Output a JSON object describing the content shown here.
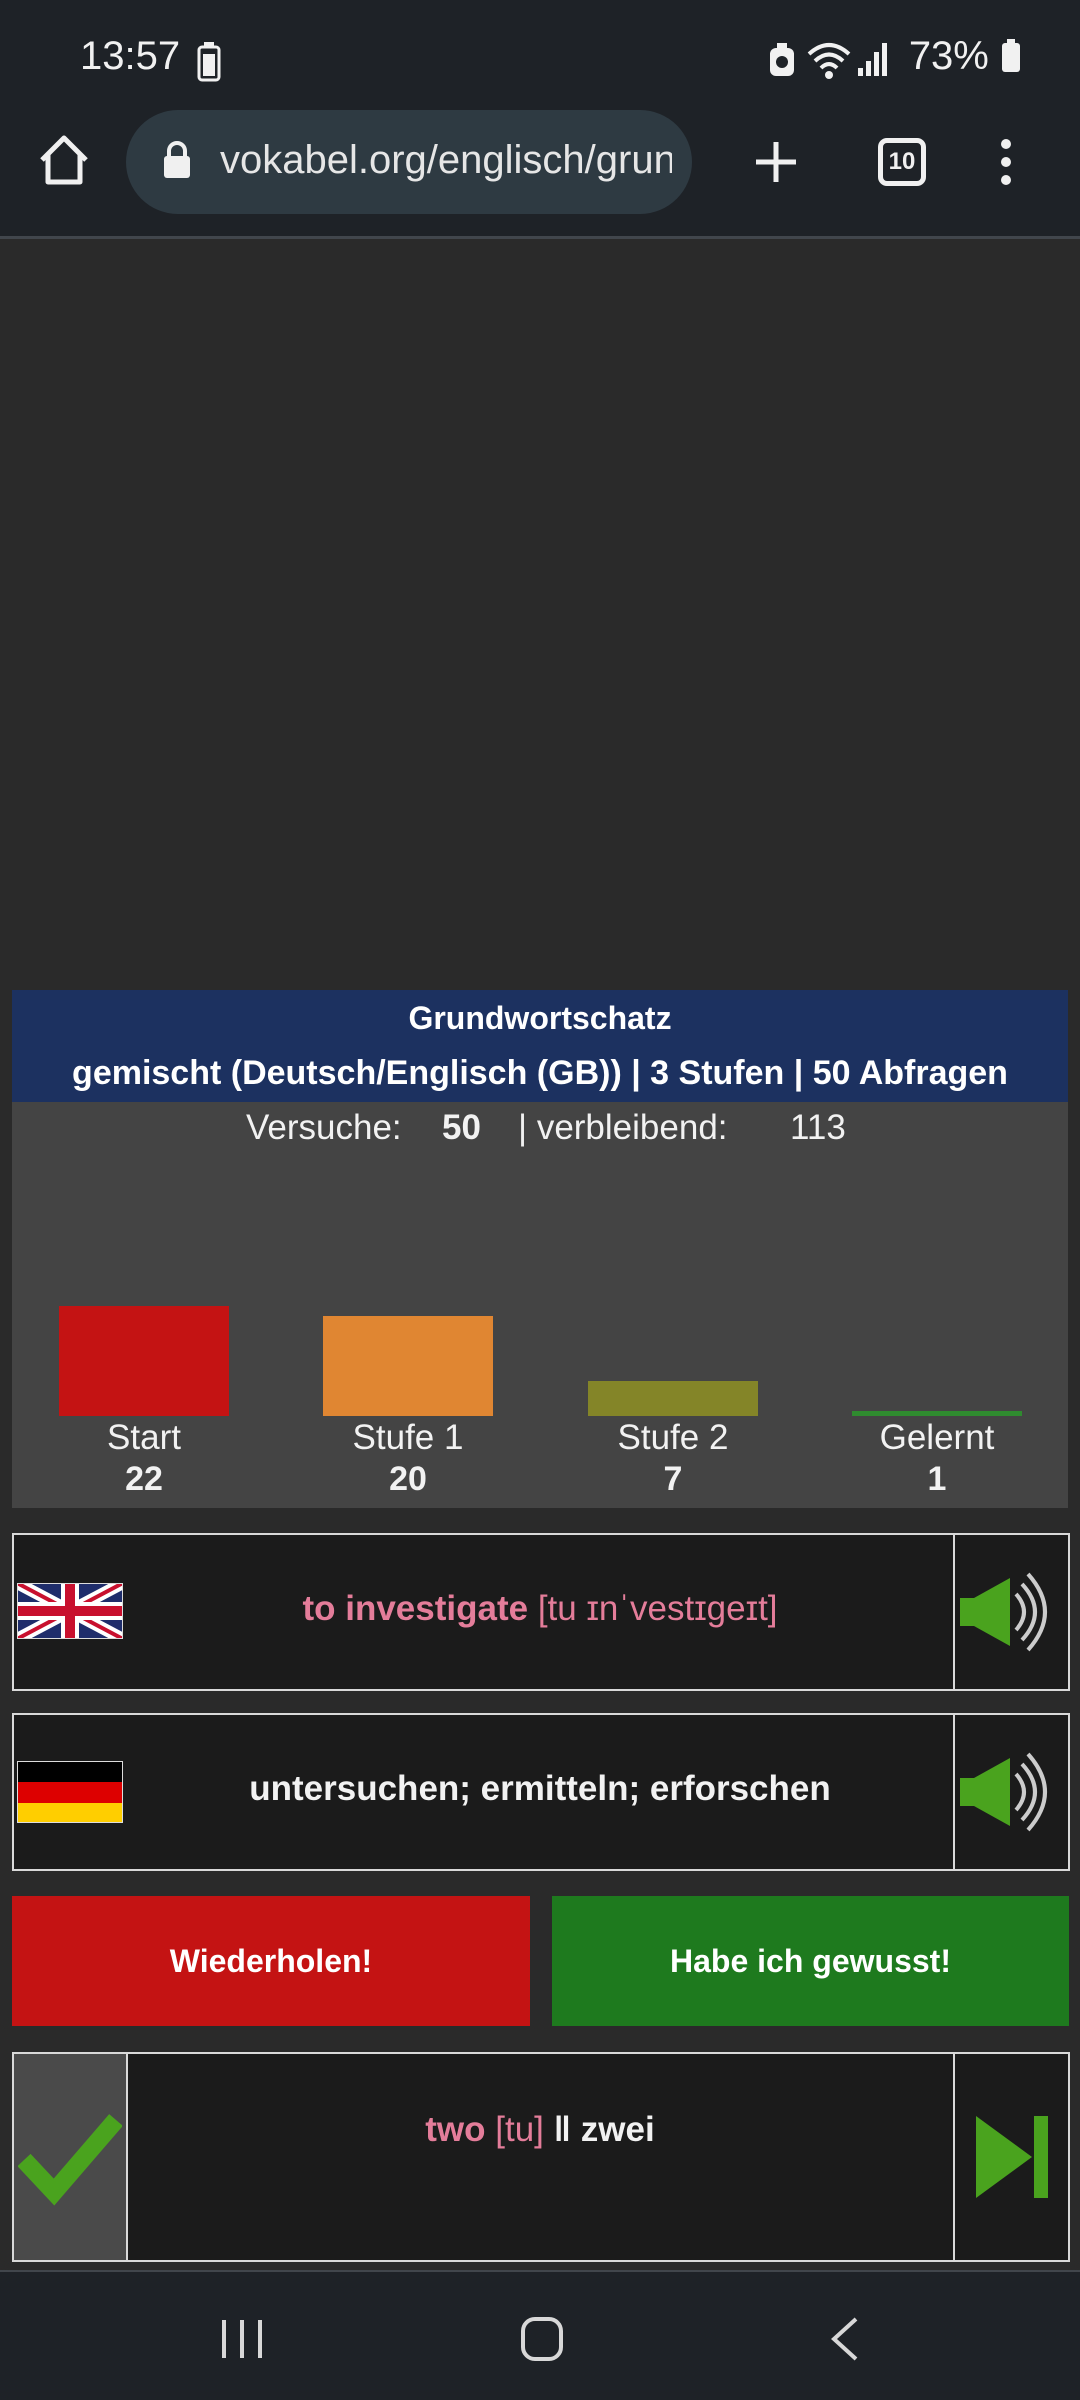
{
  "status_bar": {
    "time": "13:57",
    "battery": "73%"
  },
  "browser": {
    "url": "vokabel.org/englisch/grundwortschatz",
    "tab_count": "10"
  },
  "quiz": {
    "title": "Grundwortschatz",
    "subtitle": "gemischt (Deutsch/Englisch (GB)) | 3 Stufen | 50 Abfragen",
    "attempts_label": "Versuche:",
    "attempts_value": "50",
    "remaining_label": "| verbleibend:",
    "remaining_value": "113"
  },
  "chart_data": {
    "type": "bar",
    "categories": [
      "Start",
      "Stufe 1",
      "Stufe 2",
      "Gelernt"
    ],
    "values": [
      22,
      20,
      7,
      1
    ],
    "colors": [
      "#c41313",
      "#e08632",
      "#848528",
      "#2f8b2f"
    ],
    "value_labels": [
      "22",
      "20",
      "7",
      "1"
    ]
  },
  "card_english": {
    "word": "to investigate",
    "phonetic": "[tu ɪnˈvestɪgeɪt]",
    "flag": "uk-flag-icon",
    "audio_icon": "speaker-icon"
  },
  "card_german": {
    "translation": "untersuchen; ermitteln; erforschen",
    "flag": "germany-flag-icon",
    "audio_icon": "speaker-icon"
  },
  "actions": {
    "repeat_label": "Wiederholen!",
    "known_label": "Habe ich gewusst!",
    "repeat_color": "#c41313",
    "known_color": "#1e7a1e"
  },
  "previous": {
    "word": "two",
    "phonetic": "[tu]",
    "separator": "‖",
    "translation": "zwei",
    "status_icon": "checkmark-icon",
    "next_icon": "skip-next-icon"
  }
}
